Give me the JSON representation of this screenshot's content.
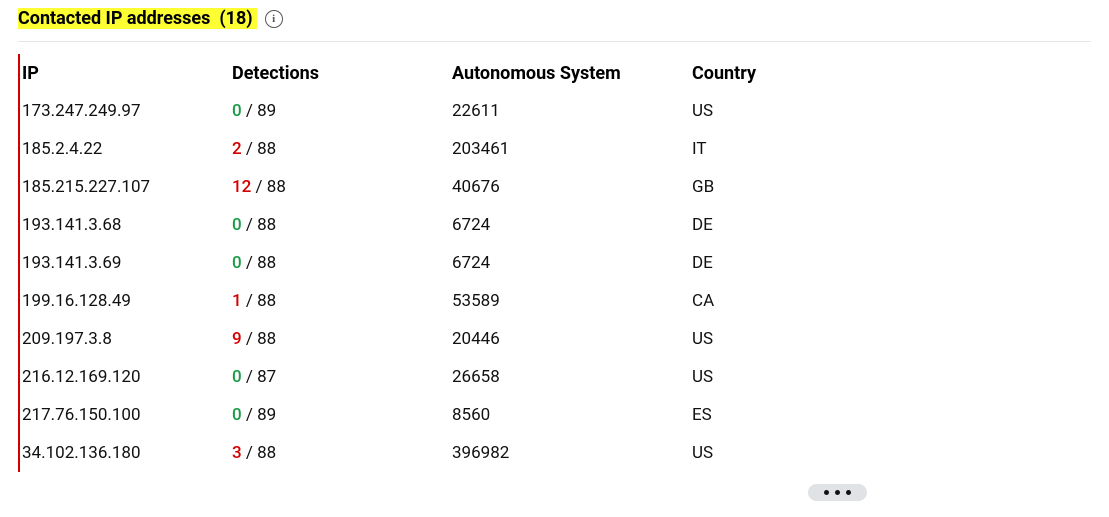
{
  "section": {
    "title": "Contacted IP addresses",
    "count": "(18)"
  },
  "headers": {
    "ip": "IP",
    "detections": "Detections",
    "as": "Autonomous System",
    "country": "Country"
  },
  "rows": [
    {
      "ip": "173.247.249.97",
      "hits": "0",
      "total": "89",
      "as": "22611",
      "country": "US"
    },
    {
      "ip": "185.2.4.22",
      "hits": "2",
      "total": "88",
      "as": "203461",
      "country": "IT"
    },
    {
      "ip": "185.215.227.107",
      "hits": "12",
      "total": "88",
      "as": "40676",
      "country": "GB"
    },
    {
      "ip": "193.141.3.68",
      "hits": "0",
      "total": "88",
      "as": "6724",
      "country": "DE"
    },
    {
      "ip": "193.141.3.69",
      "hits": "0",
      "total": "88",
      "as": "6724",
      "country": "DE"
    },
    {
      "ip": "199.16.128.49",
      "hits": "1",
      "total": "88",
      "as": "53589",
      "country": "CA"
    },
    {
      "ip": "209.197.3.8",
      "hits": "9",
      "total": "88",
      "as": "20446",
      "country": "US"
    },
    {
      "ip": "216.12.169.120",
      "hits": "0",
      "total": "87",
      "as": "26658",
      "country": "US"
    },
    {
      "ip": "217.76.150.100",
      "hits": "0",
      "total": "89",
      "as": "8560",
      "country": "ES"
    },
    {
      "ip": "34.102.136.180",
      "hits": "3",
      "total": "88",
      "as": "396982",
      "country": "US"
    }
  ]
}
